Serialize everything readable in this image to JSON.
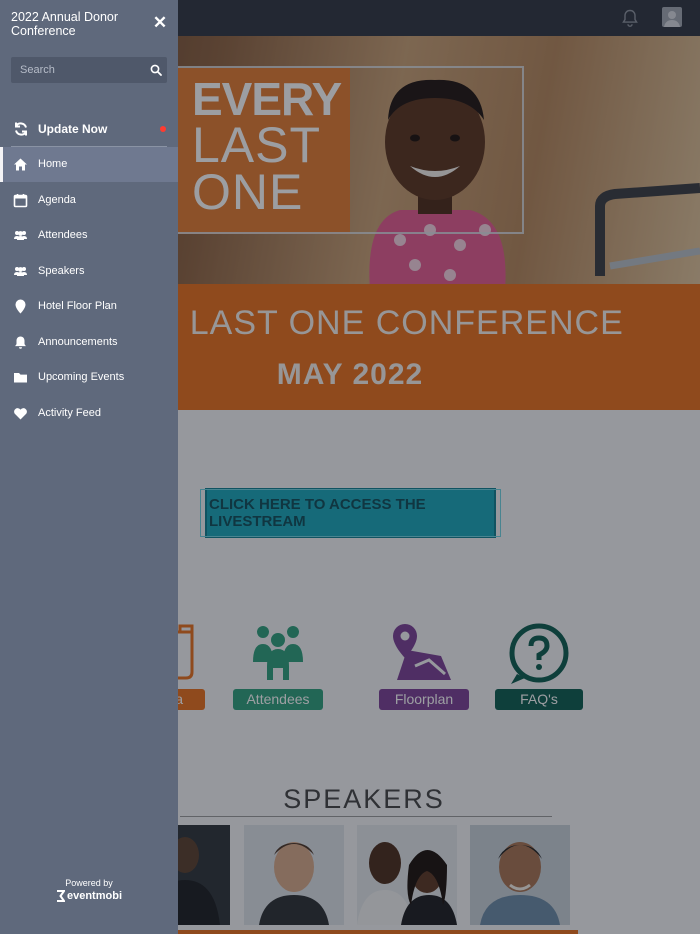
{
  "drawer": {
    "title": "2022 Annual Donor Conference",
    "close_glyph": "✕",
    "search": {
      "placeholder": "Search"
    },
    "update": {
      "label": "Update Now"
    },
    "nav": [
      {
        "label": "Home",
        "icon": "home-icon",
        "active": true
      },
      {
        "label": "Agenda",
        "icon": "calendar-icon"
      },
      {
        "label": "Attendees",
        "icon": "people-icon"
      },
      {
        "label": "Speakers",
        "icon": "people-icon"
      },
      {
        "label": "Hotel Floor Plan",
        "icon": "map-pin-icon"
      },
      {
        "label": "Announcements",
        "icon": "bell-icon"
      },
      {
        "label": "Upcoming Events",
        "icon": "folder-icon"
      },
      {
        "label": "Activity Feed",
        "icon": "heart-icon"
      }
    ],
    "powered_by": "Powered by",
    "brand": "eventmobi"
  },
  "hero": {
    "logo_line1": "EVERY",
    "logo_line2": "LAST",
    "logo_line3": "ONE"
  },
  "conference": {
    "title": "Y LAST ONE CONFERENCE",
    "date": "MAY 2022"
  },
  "livestream": {
    "label": "CLICK HERE TO ACCESS THE LIVESTREAM"
  },
  "tiles": {
    "agenda": {
      "label": "a",
      "color": "#e96f1b"
    },
    "attendees": {
      "label": "Attendees",
      "color": "#2e9f7a"
    },
    "floorplan": {
      "label": "Floorplan",
      "color": "#7b3f94"
    },
    "faq": {
      "label": "FAQ's",
      "color": "#0c5c4e"
    }
  },
  "speakers": {
    "heading": "SPEAKERS"
  },
  "colors": {
    "accent_orange": "#e96f1b",
    "drawer_bg": "#5f697c",
    "livestream_teal": "#19a6b9",
    "update_dot": "#ff3b30"
  }
}
